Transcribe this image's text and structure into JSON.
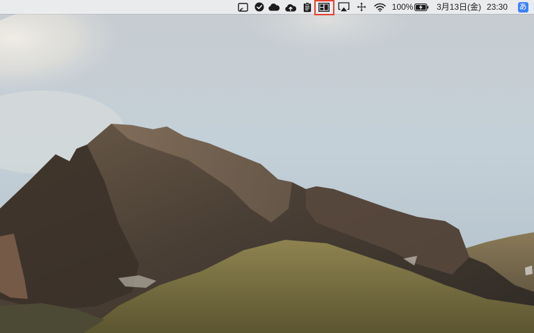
{
  "menubar": {
    "battery_percent": "100%",
    "date": "3月13日(金)",
    "time": "23:30",
    "input_method": "あ",
    "icons": [
      "screen-mirror-icon",
      "check-circle-icon",
      "cloud-icon",
      "cloud-upload-icon",
      "clipboard-icon",
      "window-grid-icon",
      "airplay-icon",
      "move-arrows-icon",
      "wifi-icon",
      "battery-charging-icon"
    ],
    "highlight_color": "#e8402f"
  },
  "desktop": {
    "wallpaper": "mountain-landscape"
  }
}
